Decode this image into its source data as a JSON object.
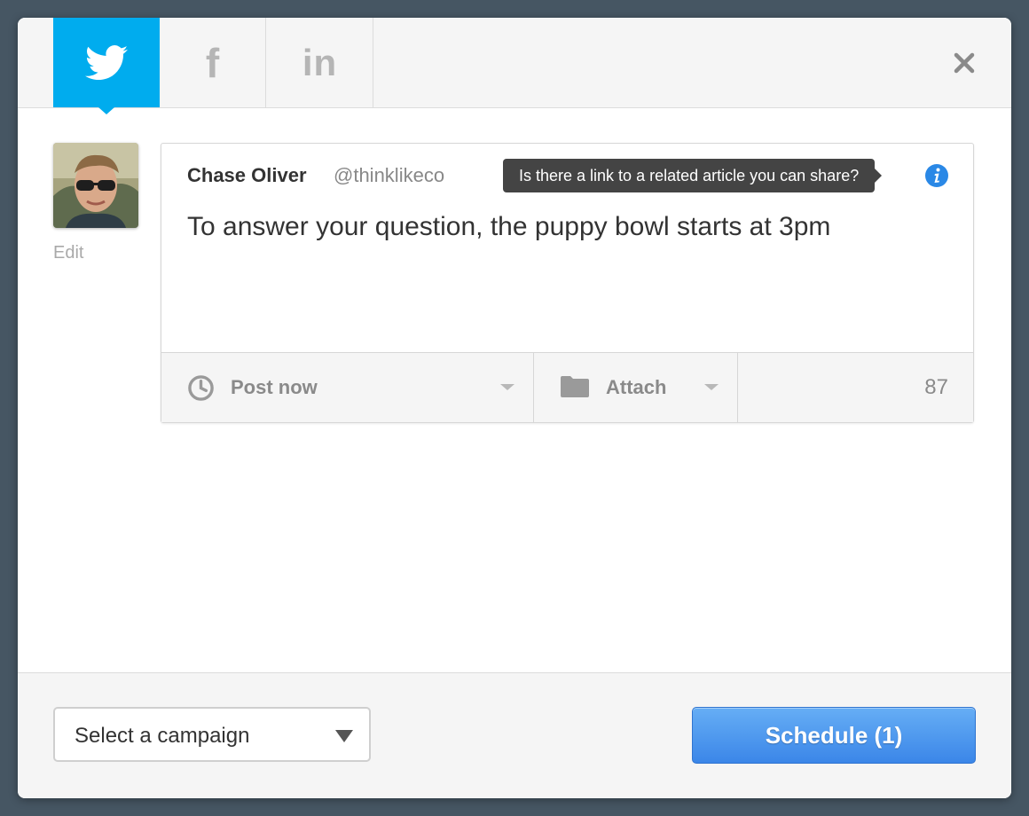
{
  "tabs": [
    {
      "icon": "twitter-icon",
      "active": true
    },
    {
      "icon": "facebook-icon",
      "glyph": "f"
    },
    {
      "icon": "linkedin-icon",
      "glyph": "in"
    }
  ],
  "close_icon": "close-icon",
  "profile": {
    "edit_label": "Edit",
    "name": "Chase Oliver",
    "handle": "@thinklikeco"
  },
  "composer": {
    "text": "To answer your question, the puppy bowl starts at 3pm",
    "tooltip": "Is there a link to a related article you can share?"
  },
  "toolbar": {
    "post_label": "Post now",
    "attach_label": "Attach",
    "char_count": "87"
  },
  "footer": {
    "campaign_placeholder": "Select a campaign",
    "schedule_label": "Schedule (1)"
  },
  "colors": {
    "twitter_blue": "#00acee",
    "button_blue": "#3b86e8",
    "backdrop": "#465663",
    "info_blue": "#2a88e6"
  }
}
